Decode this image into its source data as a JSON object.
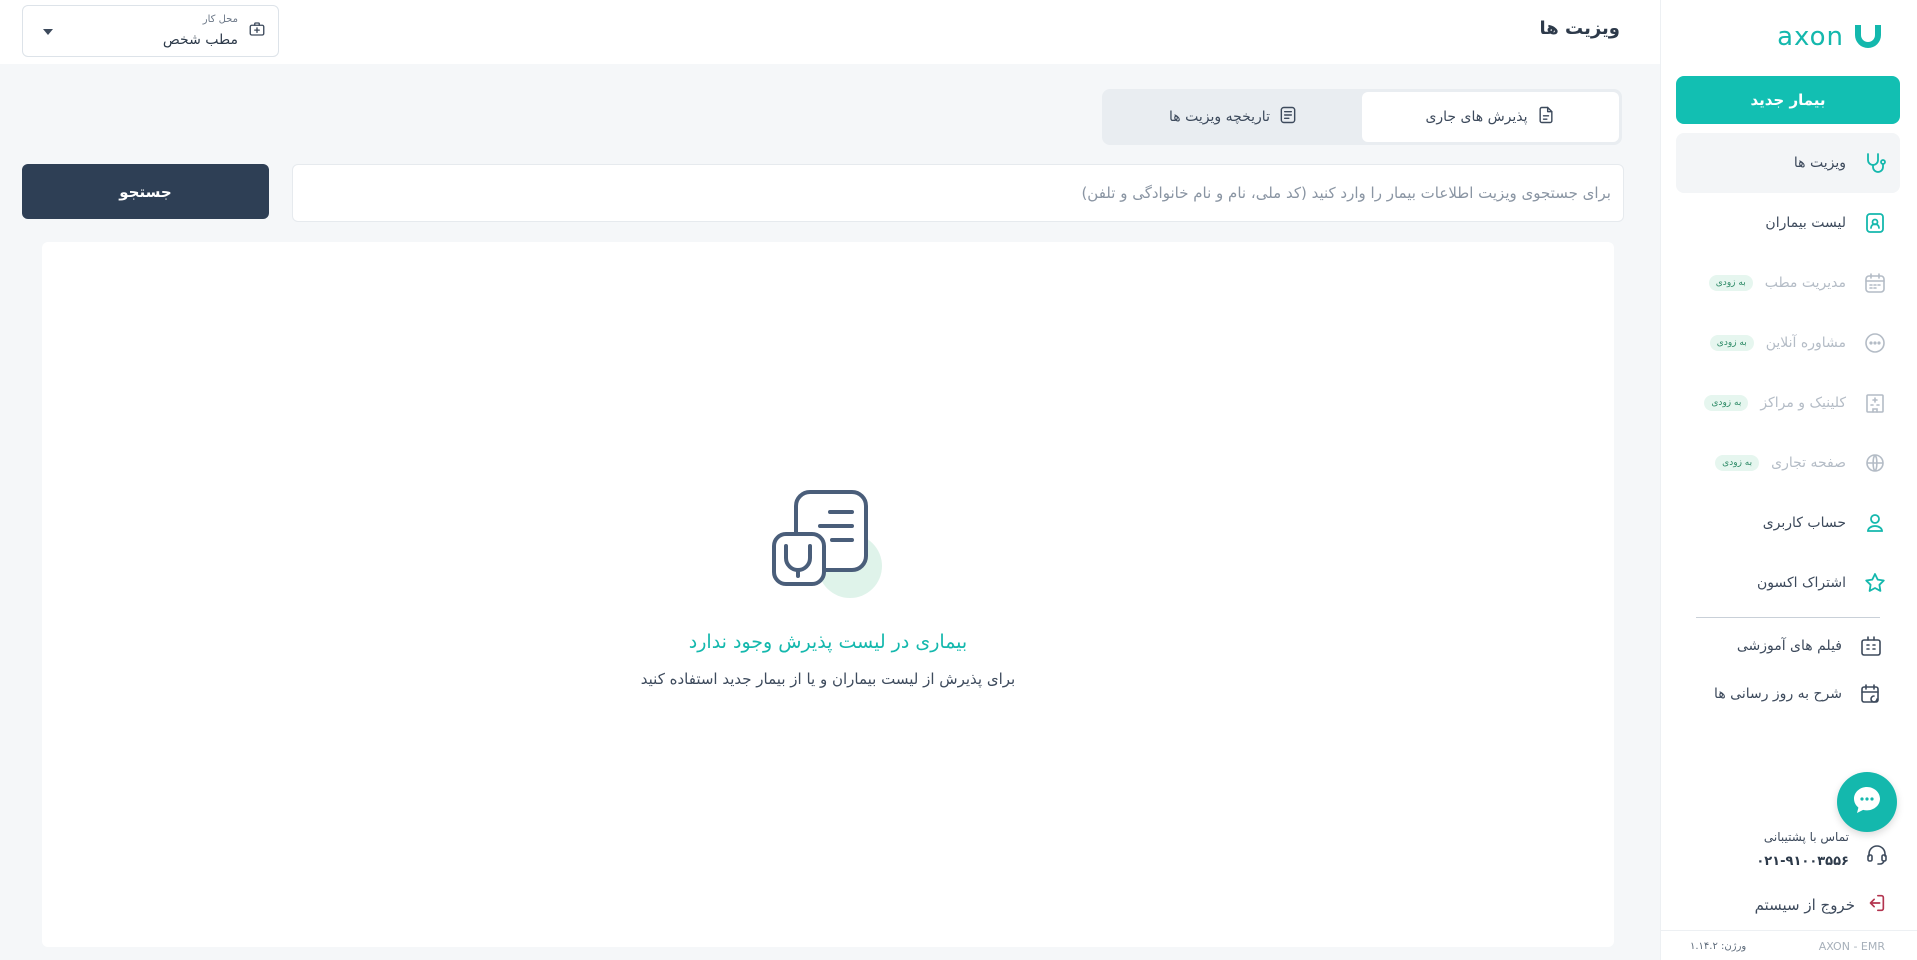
{
  "brand": {
    "logo_text": "axon",
    "accent": "#14b8ad"
  },
  "sidebar": {
    "new_patient_label": "بیمار جدید",
    "items": [
      {
        "label": "ویزیت ها",
        "icon": "stethoscope-icon",
        "active": true
      },
      {
        "label": "لیست بیماران",
        "icon": "patient-list-icon"
      },
      {
        "label": "مدیریت مطب",
        "icon": "calendar-icon",
        "disabled": true,
        "badge": "به زودی"
      },
      {
        "label": "مشاوره آنلاین",
        "icon": "chat-bubble-icon",
        "disabled": true,
        "badge": "به زودی"
      },
      {
        "label": "کلینیک و مراکز",
        "icon": "hospital-building-icon",
        "disabled": true,
        "badge": "به زودی"
      },
      {
        "label": "صفحه تجاری",
        "icon": "globe-icon",
        "disabled": true,
        "badge": "به زودی"
      },
      {
        "label": "حساب کاربری",
        "icon": "user-icon"
      },
      {
        "label": "اشتراک اکسون",
        "icon": "star-icon"
      }
    ],
    "secondary_items": [
      {
        "label": "فیلم های آموزشی",
        "icon": "video-tutorial-icon"
      },
      {
        "label": "شرح به روز رسانی ها",
        "icon": "calendar-update-icon"
      }
    ],
    "support": {
      "title": "تماس با پشتیبانی",
      "phone": "۰۲۱-۹۱۰۰۳۵۵۶"
    },
    "logout_label": "خروج از سیستم",
    "footer": {
      "brand": "AXON - EMR",
      "version": "ورژن: ۱.۱۴.۲"
    }
  },
  "header": {
    "title": "ویزیت ها",
    "workplace": {
      "caption": "محل کار",
      "value": "مطب شخص"
    }
  },
  "main": {
    "tabs": [
      {
        "label": "پذیرش های جاری",
        "icon": "document-icon",
        "active": true
      },
      {
        "label": "تاریخچه ویزیت ها",
        "icon": "list-document-icon"
      }
    ],
    "search": {
      "placeholder": "برای جستجوی ویزیت اطلاعات بیمار را وارد کنید (کد ملی، نام و نام خانوادگی و تلفن)",
      "button_label": "جستجو"
    },
    "empty_state": {
      "title": "بیماری در لیست پذیرش وجود ندارد",
      "subtitle": "برای پذیرش از لیست بیماران و یا از بیمار جدید استفاده کنید"
    }
  }
}
